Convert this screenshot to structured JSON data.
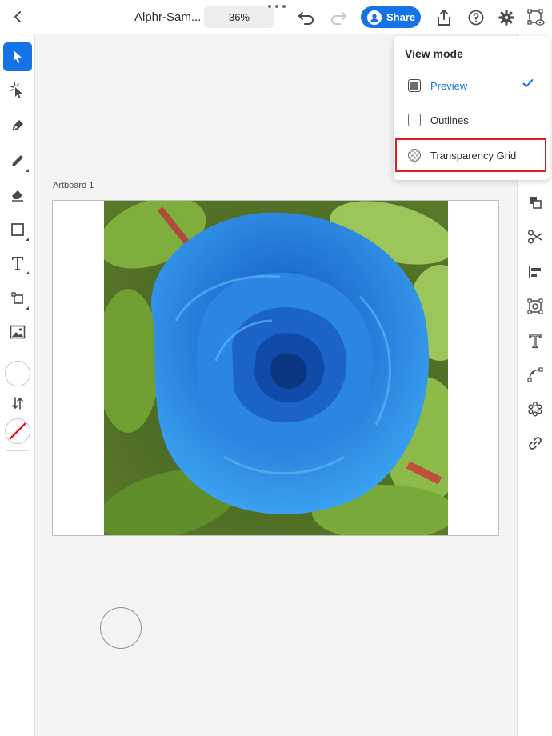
{
  "header": {
    "document_title": "Alphr-Sam...",
    "zoom": "36%",
    "share_label": "Share"
  },
  "canvas": {
    "artboard_label": "Artboard 1"
  },
  "view_mode_menu": {
    "title": "View mode",
    "items": [
      {
        "label": "Preview",
        "selected": true
      },
      {
        "label": "Outlines",
        "selected": false
      },
      {
        "label": "Transparency Grid",
        "selected": false
      }
    ]
  },
  "colors": {
    "accent": "#1473e6",
    "highlight": "#e01b24"
  }
}
